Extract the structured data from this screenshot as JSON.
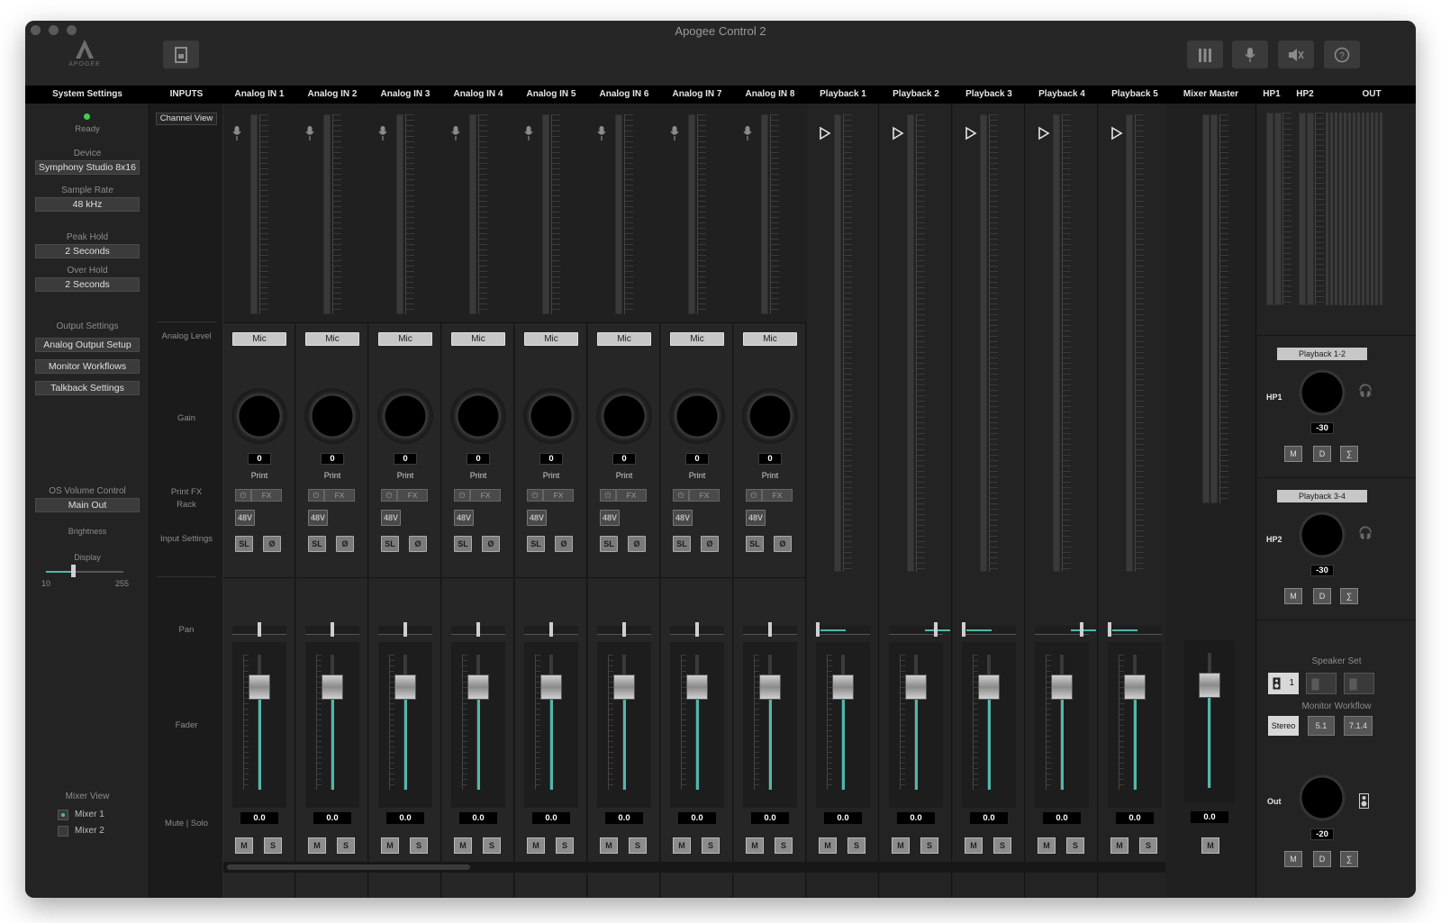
{
  "window": {
    "title": "Apogee Control 2"
  },
  "logo": {
    "text": "APOGEE"
  },
  "toolbar": {
    "icons": [
      "document-icon",
      "meters-icon",
      "mic-icon",
      "speaker-mute-icon",
      "help-icon"
    ]
  },
  "header": {
    "system_settings": "System Settings",
    "inputs": "INPUTS",
    "mixer_master": "Mixer Master",
    "hp1": "HP1",
    "hp2": "HP2",
    "out": "OUT"
  },
  "system": {
    "status": "Ready",
    "status_color": "#3ecf4a",
    "device_label": "Device",
    "device_value": "Symphony Studio 8x16",
    "sample_rate_label": "Sample Rate",
    "sample_rate_value": "48 kHz",
    "peak_hold_label": "Peak Hold",
    "peak_hold_value": "2 Seconds",
    "over_hold_label": "Over Hold",
    "over_hold_value": "2 Seconds",
    "output_settings_label": "Output Settings",
    "analog_output_setup": "Analog Output Setup",
    "monitor_workflows": "Monitor Workflows",
    "talkback_settings": "Talkback Settings",
    "os_volume_label": "OS Volume Control",
    "os_volume_value": "Main Out",
    "brightness_label": "Brightness",
    "display_label": "Display",
    "brightness_min": "10",
    "brightness_max": "255",
    "brightness_level": 0.35,
    "mixer_view_label": "Mixer View",
    "mixer1": "Mixer 1",
    "mixer2": "Mixer 2"
  },
  "labels": {
    "channel_view": "Channel View",
    "analog_level": "Analog Level",
    "gain": "Gain",
    "print_fx_rack": "Print FX Rack",
    "input_settings": "Input Settings",
    "pan": "Pan",
    "fader": "Fader",
    "mute_solo": "Mute | Solo"
  },
  "input_channels": [
    {
      "name": "Analog IN 1",
      "level": "Mic",
      "gain": "0",
      "print": "Print",
      "fx": "FX",
      "p48": "48V",
      "sl": "SL",
      "phase": "Ø",
      "fader": "0.0",
      "m": "M",
      "s": "S"
    },
    {
      "name": "Analog IN 2",
      "level": "Mic",
      "gain": "0",
      "print": "Print",
      "fx": "FX",
      "p48": "48V",
      "sl": "SL",
      "phase": "Ø",
      "fader": "0.0",
      "m": "M",
      "s": "S"
    },
    {
      "name": "Analog IN 3",
      "level": "Mic",
      "gain": "0",
      "print": "Print",
      "fx": "FX",
      "p48": "48V",
      "sl": "SL",
      "phase": "Ø",
      "fader": "0.0",
      "m": "M",
      "s": "S"
    },
    {
      "name": "Analog IN 4",
      "level": "Mic",
      "gain": "0",
      "print": "Print",
      "fx": "FX",
      "p48": "48V",
      "sl": "SL",
      "phase": "Ø",
      "fader": "0.0",
      "m": "M",
      "s": "S"
    },
    {
      "name": "Analog IN 5",
      "level": "Mic",
      "gain": "0",
      "print": "Print",
      "fx": "FX",
      "p48": "48V",
      "sl": "SL",
      "phase": "Ø",
      "fader": "0.0",
      "m": "M",
      "s": "S"
    },
    {
      "name": "Analog IN 6",
      "level": "Mic",
      "gain": "0",
      "print": "Print",
      "fx": "FX",
      "p48": "48V",
      "sl": "SL",
      "phase": "Ø",
      "fader": "0.0",
      "m": "M",
      "s": "S"
    },
    {
      "name": "Analog IN 7",
      "level": "Mic",
      "gain": "0",
      "print": "Print",
      "fx": "FX",
      "p48": "48V",
      "sl": "SL",
      "phase": "Ø",
      "fader": "0.0",
      "m": "M",
      "s": "S"
    },
    {
      "name": "Analog IN 8",
      "level": "Mic",
      "gain": "0",
      "print": "Print",
      "fx": "FX",
      "p48": "48V",
      "sl": "SL",
      "phase": "Ø",
      "fader": "0.0",
      "m": "M",
      "s": "S"
    }
  ],
  "playback_channels": [
    {
      "name": "Playback 1",
      "fader": "0.0",
      "m": "M",
      "s": "S"
    },
    {
      "name": "Playback 2",
      "fader": "0.0",
      "m": "M",
      "s": "S"
    },
    {
      "name": "Playback 3",
      "fader": "0.0",
      "m": "M",
      "s": "S"
    },
    {
      "name": "Playback 4",
      "fader": "0.0",
      "m": "M",
      "s": "S"
    },
    {
      "name": "Playback 5",
      "fader": "0.0",
      "m": "M",
      "s": "S"
    }
  ],
  "master": {
    "fader": "0.0",
    "m": "M"
  },
  "right": {
    "hp1_source": "Playback 1-2",
    "hp1_label": "HP1",
    "hp1_value": "-30",
    "hp2_source": "Playback 3-4",
    "hp2_label": "HP2",
    "hp2_value": "-30",
    "m": "M",
    "d": "D",
    "sum": "∑",
    "speaker_set_label": "Speaker Set",
    "speaker1": "1",
    "monitor_workflow_label": "Monitor Workflow",
    "stereo": "Stereo",
    "five_one": "5.1",
    "seven_one_four": "7.1.4",
    "out_label": "Out",
    "out_value": "-20",
    "accent": "#4fb8ad"
  }
}
